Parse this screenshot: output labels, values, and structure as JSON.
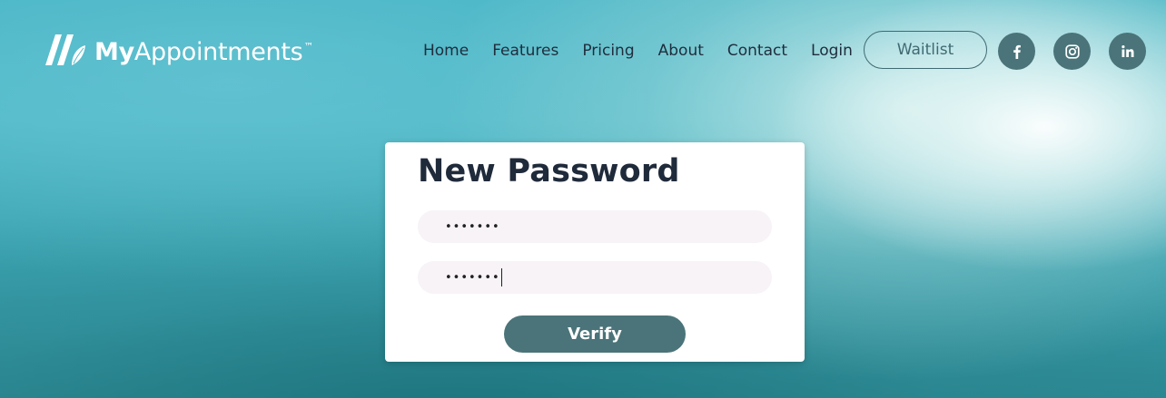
{
  "header": {
    "logo": {
      "bold_text": "My",
      "light_text": "Appointments",
      "trademark": "™"
    },
    "nav": [
      {
        "label": "Home"
      },
      {
        "label": "Features"
      },
      {
        "label": "Pricing"
      },
      {
        "label": "About"
      },
      {
        "label": "Contact"
      },
      {
        "label": "Login"
      }
    ],
    "waitlist_label": "Waitlist",
    "social": [
      {
        "icon": "facebook-icon"
      },
      {
        "icon": "instagram-icon"
      },
      {
        "icon": "linkedin-icon"
      }
    ]
  },
  "card": {
    "title": "New Password",
    "password_field_1": "•••••••",
    "password_field_2": "•••••••",
    "verify_label": "Verify"
  },
  "colors": {
    "brand_dark_teal": "#4a7479",
    "title_text": "#1f2a3a",
    "nav_text": "#1f2d3d",
    "field_bg": "#f7f3f7",
    "background_teal": "#44b3c4"
  }
}
